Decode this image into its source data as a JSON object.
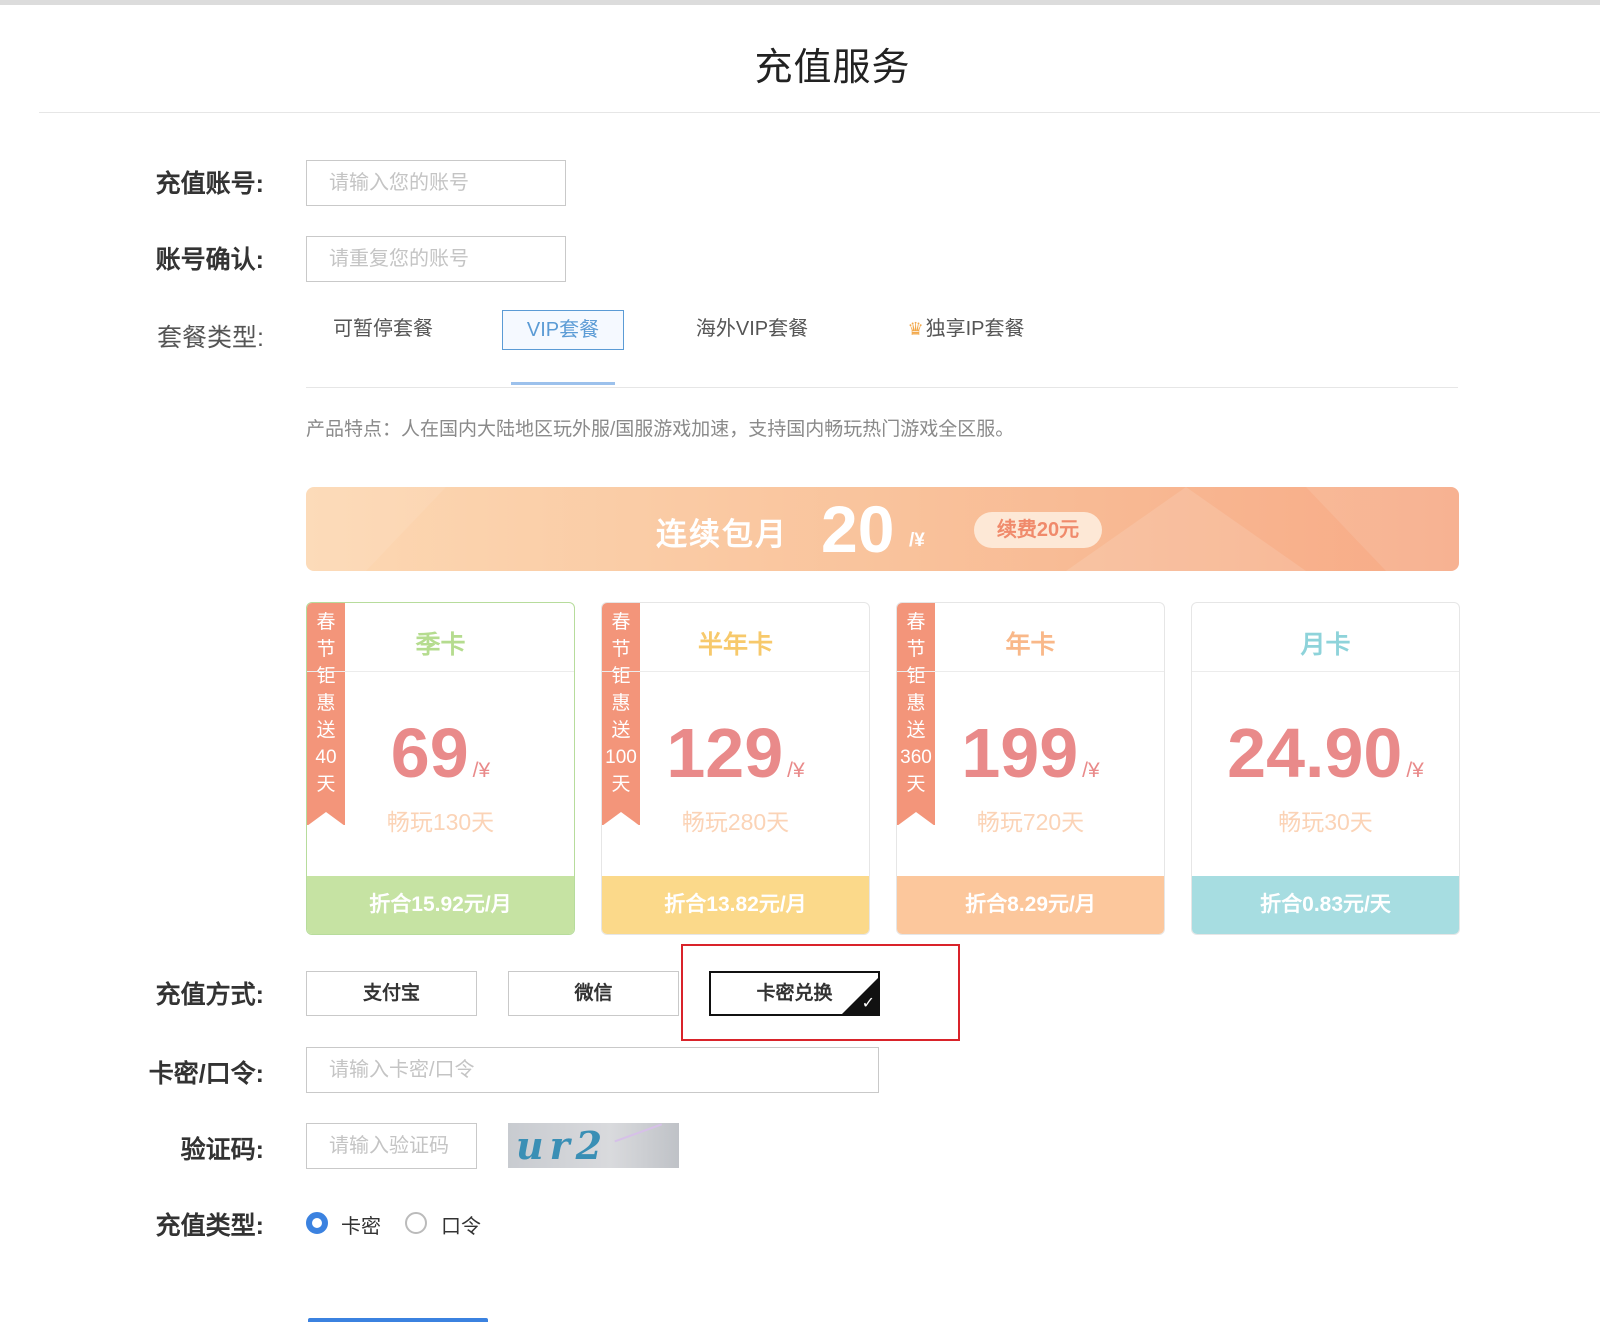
{
  "page": {
    "title": "充值服务"
  },
  "form": {
    "account_label": "充值账号:",
    "account_placeholder": "请输入您的账号",
    "confirm_label": "账号确认:",
    "confirm_placeholder": "请重复您的账号",
    "package_label": "套餐类型:",
    "method_label": "充值方式:",
    "card_label": "卡密/口令:",
    "card_placeholder": "请输入卡密/口令",
    "captcha_label": "验证码:",
    "captcha_placeholder": "请输入验证码",
    "captcha_image_text": "ur2",
    "type_label": "充值类型:"
  },
  "tabs": [
    {
      "label": "可暂停套餐",
      "active": false
    },
    {
      "label": "VIP套餐",
      "active": true
    },
    {
      "label": "海外VIP套餐",
      "active": false
    },
    {
      "label": "独享IP套餐",
      "active": false,
      "icon": "crown-icon"
    }
  ],
  "feature_text": "产品特点：人在国内大陆地区玩外服/国服游戏加速，支持国内畅玩热门游戏全区服。",
  "banner": {
    "text": "连续包月",
    "price": "20",
    "unit": "/¥",
    "renew": "续费20元"
  },
  "plans": [
    {
      "name": "季卡",
      "ribbon": [
        "春",
        "节",
        "钜",
        "惠",
        "送",
        "40",
        "天"
      ],
      "price": "69",
      "unit": "/¥",
      "days": "畅玩130天",
      "foot": "折合15.92元/月",
      "name_color": "#b5dc8f",
      "foot_color": "#c6e3a3",
      "selected": true
    },
    {
      "name": "半年卡",
      "ribbon": [
        "春",
        "节",
        "钜",
        "惠",
        "送",
        "100",
        "天"
      ],
      "price": "129",
      "unit": "/¥",
      "days": "畅玩280天",
      "foot": "折合13.82元/月",
      "name_color": "#f7c96b",
      "foot_color": "#fbd98a",
      "selected": false
    },
    {
      "name": "年卡",
      "ribbon": [
        "春",
        "节",
        "钜",
        "惠",
        "送",
        "360",
        "天"
      ],
      "price": "199",
      "unit": "/¥",
      "days": "畅玩720天",
      "foot": "折合8.29元/月",
      "name_color": "#f9b889",
      "foot_color": "#fcc79c",
      "selected": false
    },
    {
      "name": "月卡",
      "ribbon": [],
      "price": "24.90",
      "unit": "/¥",
      "days": "畅玩30天",
      "foot": "折合0.83元/天",
      "name_color": "#8ed3da",
      "foot_color": "#a7dde1",
      "selected": false
    }
  ],
  "pay_methods": [
    {
      "label": "支付宝",
      "active": false
    },
    {
      "label": "微信",
      "active": false
    },
    {
      "label": "卡密兑换",
      "active": true
    }
  ],
  "recharge_types": [
    {
      "label": "卡密",
      "checked": true
    },
    {
      "label": "口令",
      "checked": false
    }
  ],
  "colors": {
    "accent": "#3b82e0",
    "tab_active": "#5b9bd5",
    "price": "#e98a8a",
    "ribbon": "#f3957a",
    "highlight": "#d9232a"
  }
}
